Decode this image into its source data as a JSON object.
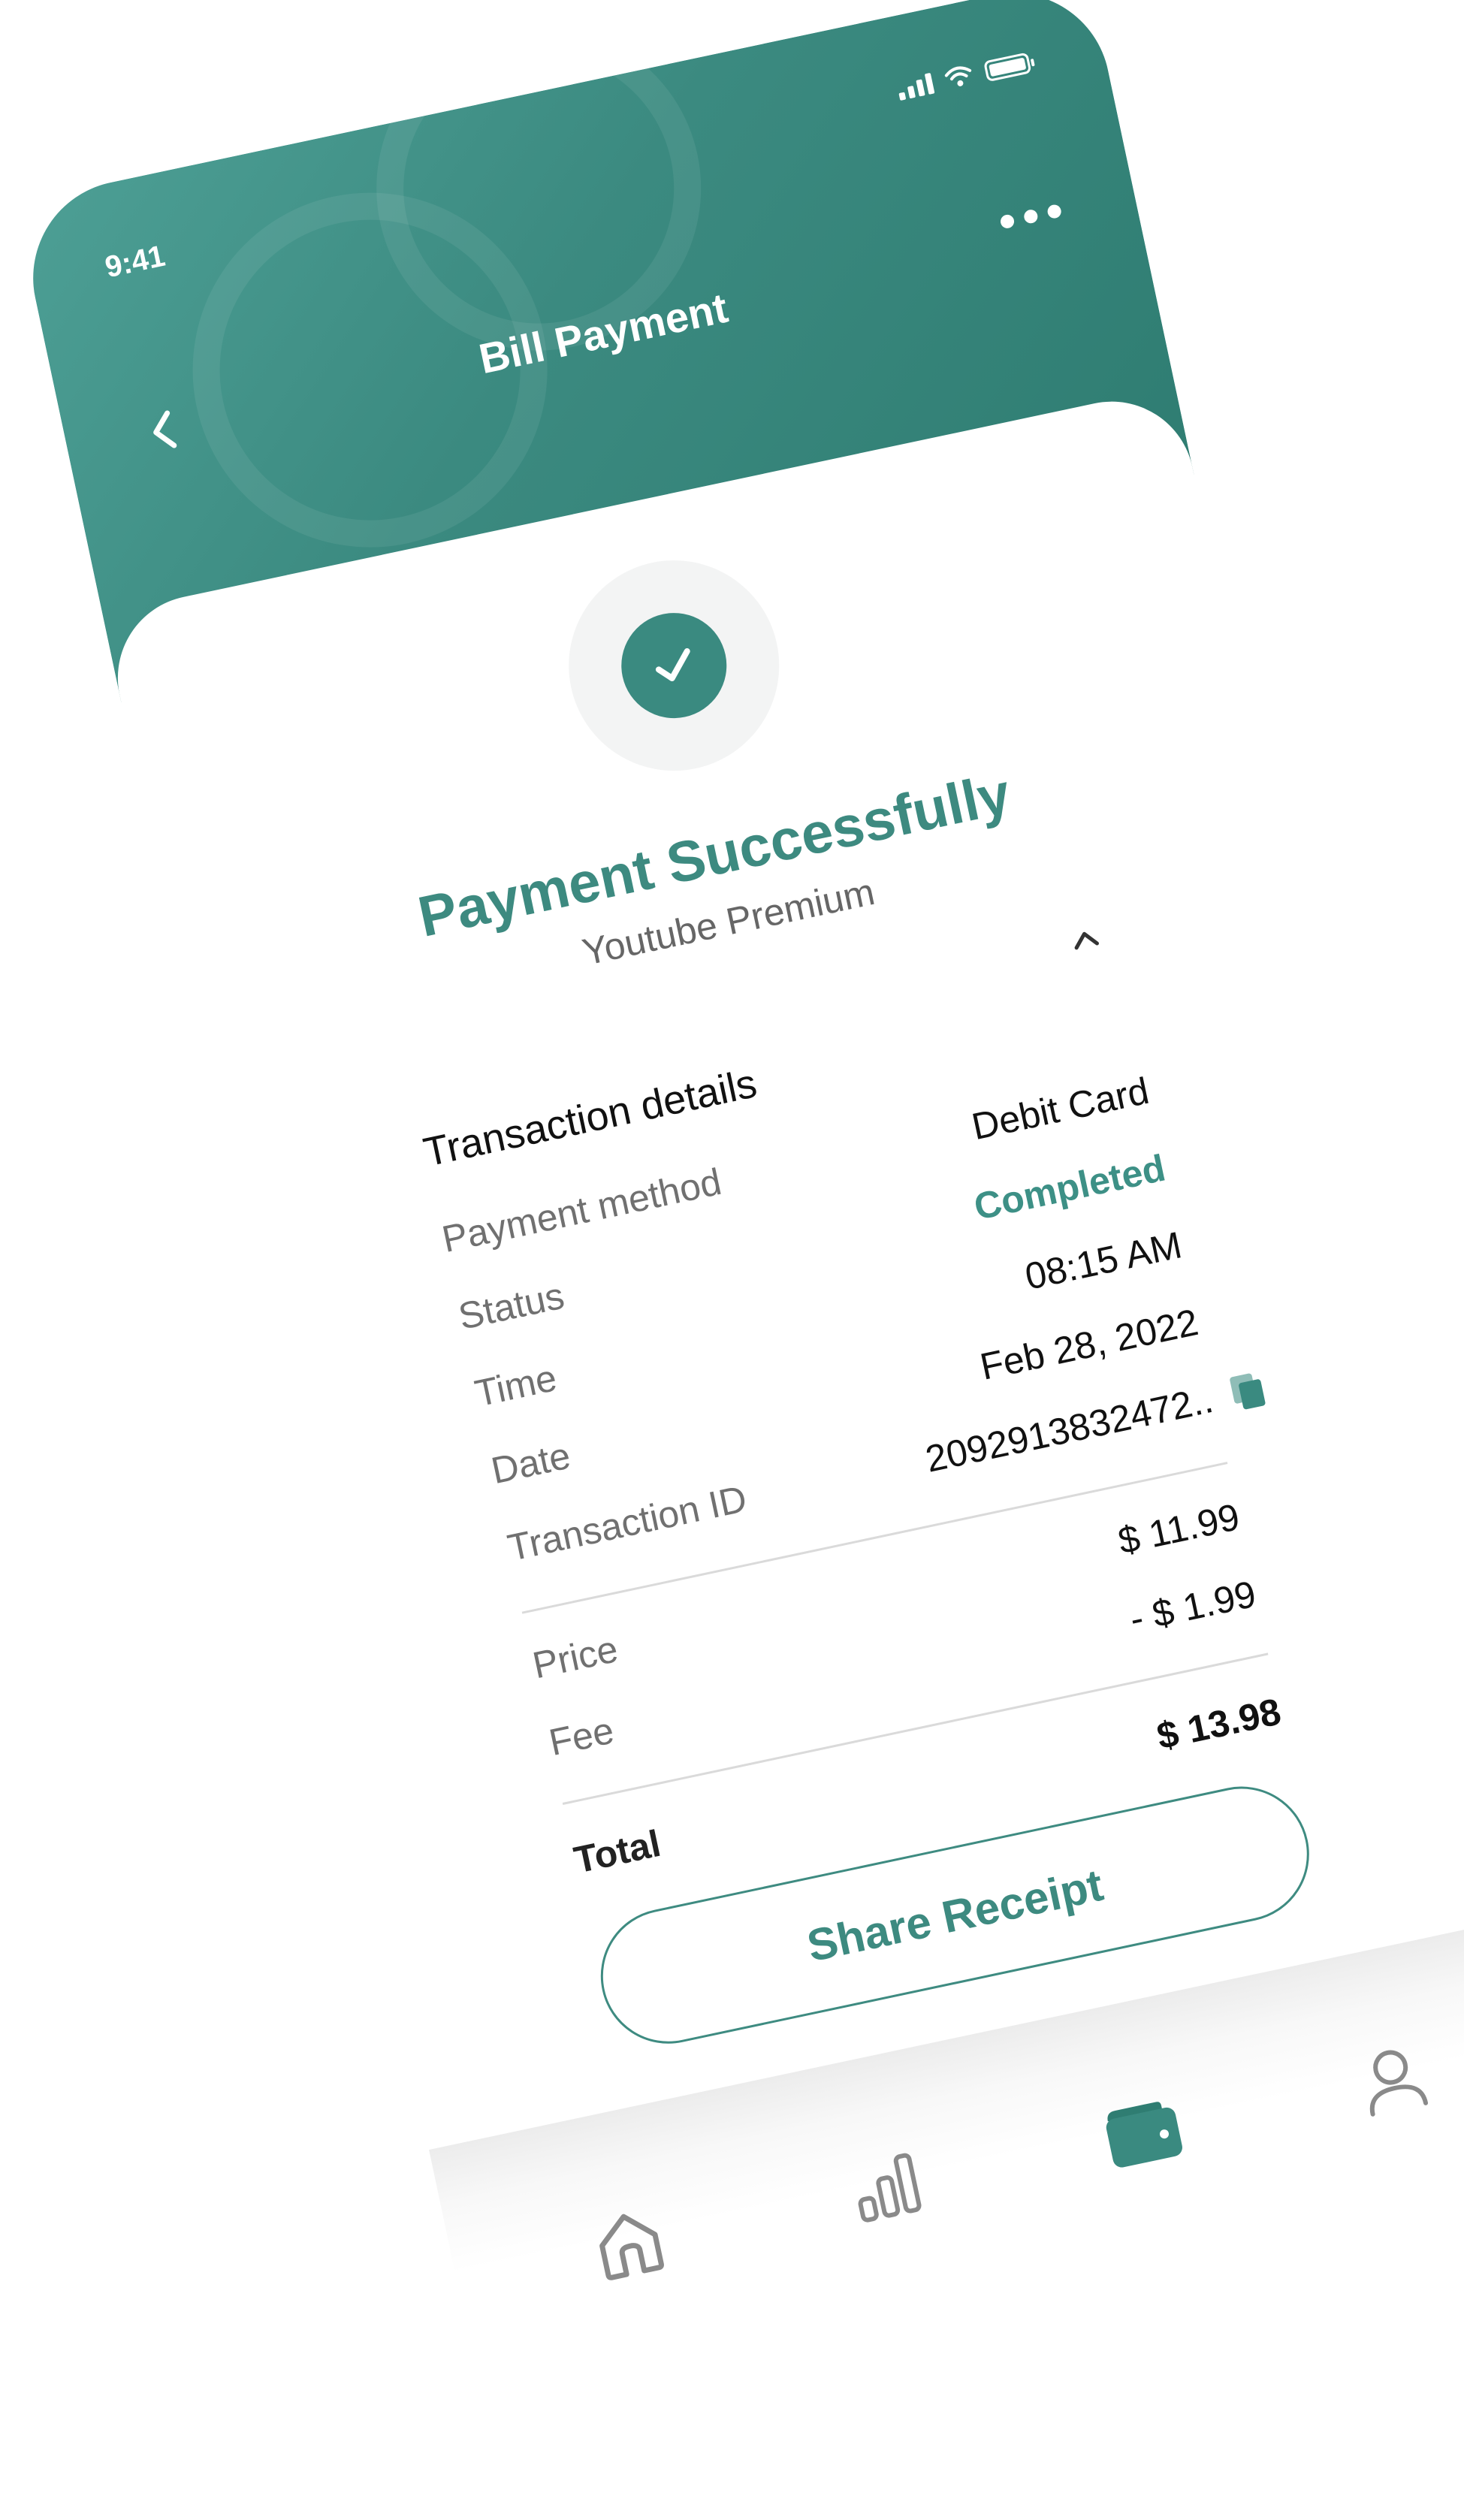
{
  "status_bar": {
    "time": "9:41"
  },
  "header": {
    "title": "Bill Payment",
    "back_icon": "chevron-left-icon",
    "more_icon": "more-horizontal-icon"
  },
  "result": {
    "icon": "check-circle-icon",
    "title": "Payment Successfully",
    "subtitle": "Youtube Premium"
  },
  "transaction": {
    "section_title": "Transaction details",
    "collapse_icon": "chevron-up-icon",
    "rows": [
      {
        "label": "Payment method",
        "value": "Debit Card"
      },
      {
        "label": "Status",
        "value": "Completed"
      },
      {
        "label": "Time",
        "value": "08:15 AM"
      },
      {
        "label": "Date",
        "value": "Feb 28, 2022"
      },
      {
        "label": "Transaction ID",
        "value": "2092913832472.."
      }
    ],
    "copy_icon": "copy-icon"
  },
  "amounts": {
    "price_label": "Price",
    "price_value": "$ 11.99",
    "fee_label": "Fee",
    "fee_value": "- $ 1.99",
    "total_label": "Total",
    "total_value": "$ 13.98"
  },
  "actions": {
    "share_label": "Share Receipt"
  },
  "tabbar": {
    "items": [
      "home-icon",
      "chart-icon",
      "wallet-icon",
      "profile-icon"
    ],
    "active": "wallet-icon"
  },
  "colors": {
    "brand": "#3a8a80",
    "status_completed": "#3d9086"
  }
}
